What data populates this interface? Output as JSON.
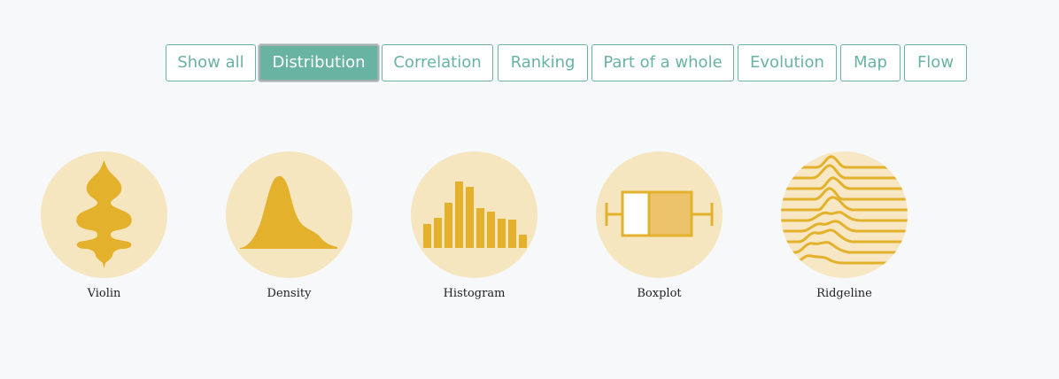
{
  "filters": [
    {
      "label": "Show all",
      "active": false
    },
    {
      "label": "Distribution",
      "active": true
    },
    {
      "label": "Correlation",
      "active": false
    },
    {
      "label": "Ranking",
      "active": false
    },
    {
      "label": "Part of a whole",
      "active": false
    },
    {
      "label": "Evolution",
      "active": false
    },
    {
      "label": "Map",
      "active": false
    },
    {
      "label": "Flow",
      "active": false
    }
  ],
  "charts": [
    {
      "label": "Violin",
      "icon": "violin-icon"
    },
    {
      "label": "Density",
      "icon": "density-icon"
    },
    {
      "label": "Histogram",
      "icon": "histogram-icon"
    },
    {
      "label": "Boxplot",
      "icon": "boxplot-icon"
    },
    {
      "label": "Ridgeline",
      "icon": "ridgeline-icon"
    }
  ],
  "colors": {
    "accent": "#69b3a2",
    "icon_fill": "#e3b12b",
    "icon_bg": "#f6e6c0",
    "page_bg": "#f7f8fa"
  }
}
